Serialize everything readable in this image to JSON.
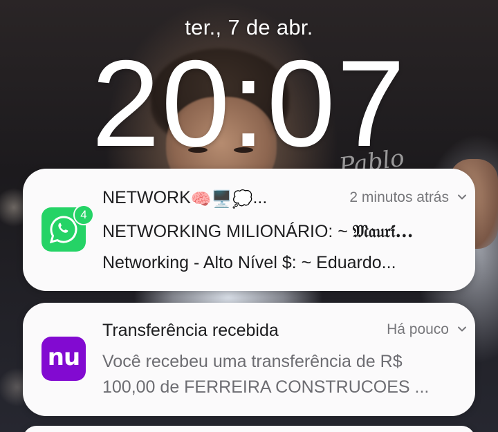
{
  "lockscreen": {
    "date": "ter., 7 de abr.",
    "time": "20:07",
    "signature": "Pablo"
  },
  "notifications": [
    {
      "app": "WhatsApp",
      "icon": "whatsapp-icon",
      "badge_count": "4",
      "title_text": "NETWORK",
      "title_emojis": "🧠🖥️💭",
      "title_ellipsis": "...",
      "time": "2 minutos atrás",
      "line1_prefix": "NETWORKING MILIONÁRIO: ~ ",
      "line1_name": "𝔐𝔞𝔲𝔯𝔦́...",
      "line2": "Networking - Alto Nível $: ~ Eduardo..."
    },
    {
      "app": "Nubank",
      "icon": "nubank-icon",
      "icon_text": "nu",
      "title": "Transferência recebida",
      "time": "Há pouco",
      "line1": "Você recebeu uma transferência de R$",
      "line2": "100,00 de FERREIRA CONSTRUCOES ..."
    }
  ],
  "colors": {
    "whatsapp": "#25d366",
    "nubank": "#820ad1",
    "card_bg": "#fbfafb"
  }
}
